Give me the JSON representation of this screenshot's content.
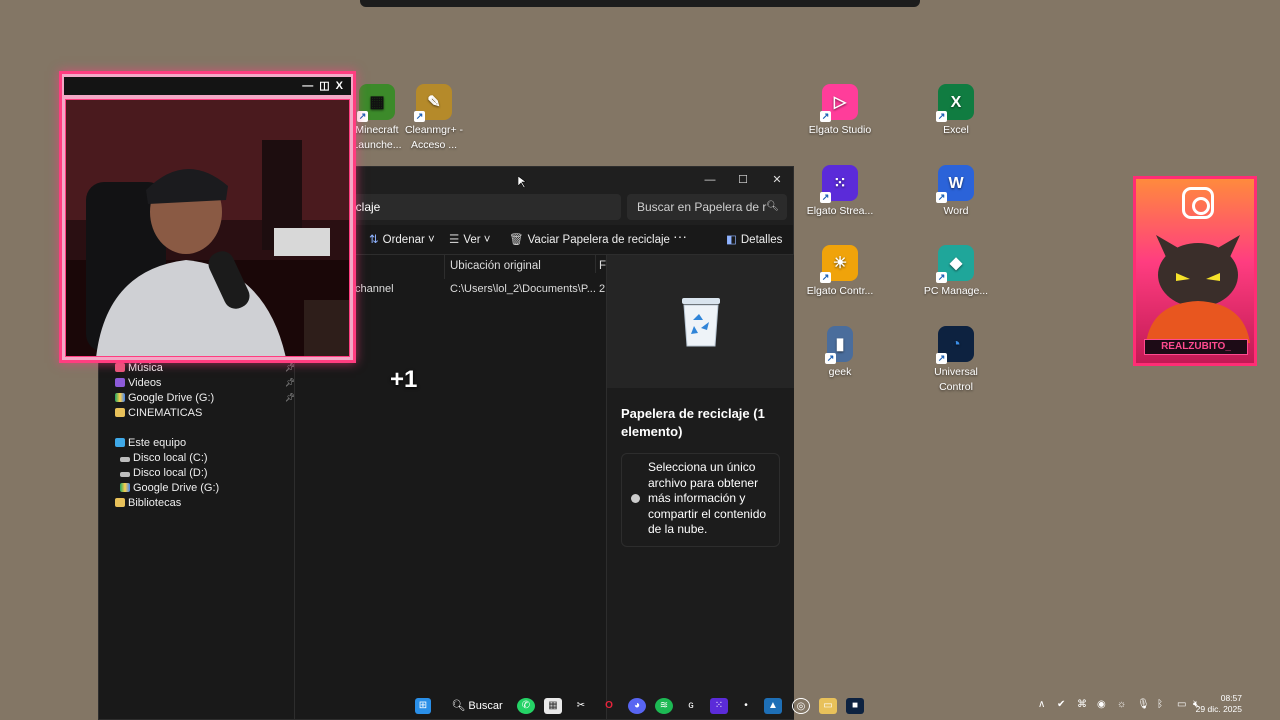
{
  "desktop": {
    "icons": [
      {
        "label": "Minecraft Launche...",
        "glyph": "▦",
        "color": "#3c8a2a"
      },
      {
        "label": "Cleanmgr+ - Acceso ...",
        "glyph": "✎",
        "color": "#b58a2a"
      },
      {
        "label": "Elgato Studio",
        "glyph": "▷",
        "color": "#ff3d9a"
      },
      {
        "label": "Excel",
        "glyph": "X",
        "color": "#107c41"
      },
      {
        "label": "Elgato Strea...",
        "glyph": "⁙",
        "color": "#5b2bd9"
      },
      {
        "label": "Word",
        "glyph": "W",
        "color": "#2b63d9"
      },
      {
        "label": "Elgato Contr...",
        "glyph": "☀",
        "color": "#f0a30a"
      },
      {
        "label": "PC Manage...",
        "glyph": "◆",
        "color": "#1fa69a"
      },
      {
        "label": "geek",
        "glyph": "▮",
        "color": "#4a6d9c"
      },
      {
        "label": "Universal Control",
        "glyph": "◔",
        "color": "#0d2240"
      }
    ]
  },
  "explorer": {
    "address": "iclaje",
    "search_placeholder": "Buscar en Papelera de r",
    "toolbar": {
      "sort": "Ordenar",
      "view": "Ver",
      "empty_bin": "Vaciar Papelera de reciclaje",
      "more": "···",
      "details": "Detalles"
    },
    "columns": {
      "original_location": "Ubicación original",
      "f": "F"
    },
    "rows": [
      {
        "name": "channel",
        "location": "C:\\Users\\lol_2\\Documents\\P...",
        "f": "2"
      }
    ],
    "sidebar": {
      "quick": [
        {
          "label": "Música",
          "pinned": true
        },
        {
          "label": "Videos",
          "pinned": true
        },
        {
          "label": "Google Drive (G:)",
          "pinned": true
        },
        {
          "label": "CINEMATICAS",
          "pinned": false
        }
      ],
      "this_pc": "Este equipo",
      "drives": [
        "Disco local (C:)",
        "Disco local (D:)",
        "Google Drive (G:)"
      ],
      "libraries": "Bibliotecas"
    },
    "details_pane": {
      "title": "Papelera de reciclaje (1 elemento)",
      "message": "Selecciona un único archivo para obtener más información y compartir el contenido de la nube."
    }
  },
  "overlay": {
    "plus_one": "+1",
    "streamer_name": "REALZUBITO_"
  },
  "taskbar": {
    "search_label": "Buscar",
    "time": "08:57",
    "date": "29 dic. 2025"
  }
}
